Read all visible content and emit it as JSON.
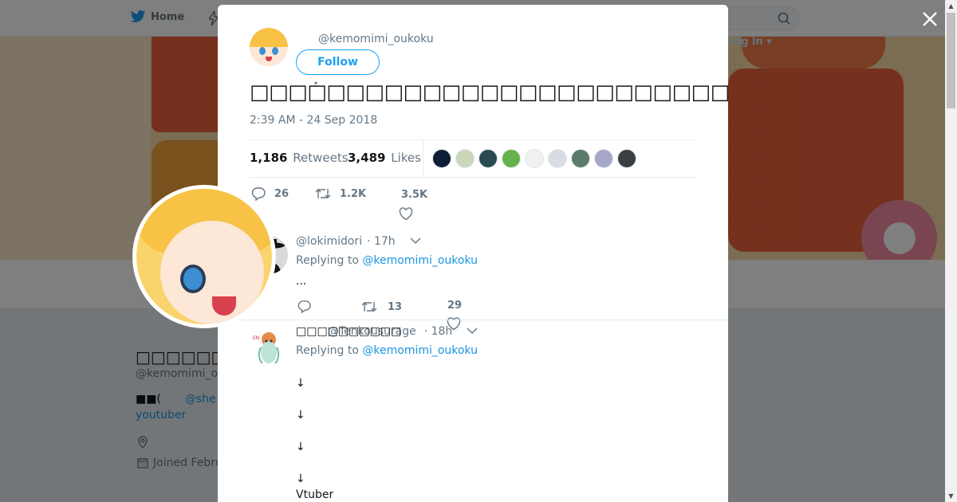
{
  "nav": {
    "home_label": "Home",
    "login_label": "Log in"
  },
  "profile": {
    "name": "□□□□□□□□□□",
    "handle": "@kemomimi_oukoku",
    "bio_line1_prefix": "■■(",
    "bio_line1_link": "@she",
    "bio_line2": "youtuber",
    "joined": "Joined Febru"
  },
  "tweet": {
    "handle": "@kemomimi_oukoku",
    "follow_label": "Follow",
    "text": "□□□□□□□□□□□□□□□□□□□□□□□□□□□□□□□□□□□□□□□□□□□□□□□□□□□□□□…□□□□□□",
    "timestamp": "2:39 AM - 24 Sep 2018",
    "retweets_count": "1,186",
    "retweets_label": "Retweets",
    "likes_count": "3,489",
    "likes_label": "Likes",
    "reply_count": "26",
    "retweet_count_short": "1.2K",
    "like_count_short": "3.5K",
    "likers": [
      "#0e1e36",
      "#c9d7b8",
      "#2a4a52",
      "#66b24a",
      "#f0f0f0",
      "#d8dde4",
      "#5a7a6a",
      "#a6a8c8",
      "#3a3f44"
    ]
  },
  "replies": [
    {
      "handle": "@lokimidori",
      "time": "· 17h",
      "replying_prefix": "Replying to",
      "replying_to": "@kemomimi_oukoku",
      "body": "...",
      "retweets": "13",
      "likes": "29"
    },
    {
      "name": "□□□□□□□□□□",
      "handle": "@Tenkousurage",
      "time": "· 18h",
      "replying_prefix": "Replying to",
      "replying_to": "@kemomimi_oukoku",
      "body": "↓\n\n↓\n\n↓\n\n↓\nVtuber"
    }
  ],
  "colors": {
    "accent": "#1da1f2",
    "link": "#1b95e0"
  }
}
